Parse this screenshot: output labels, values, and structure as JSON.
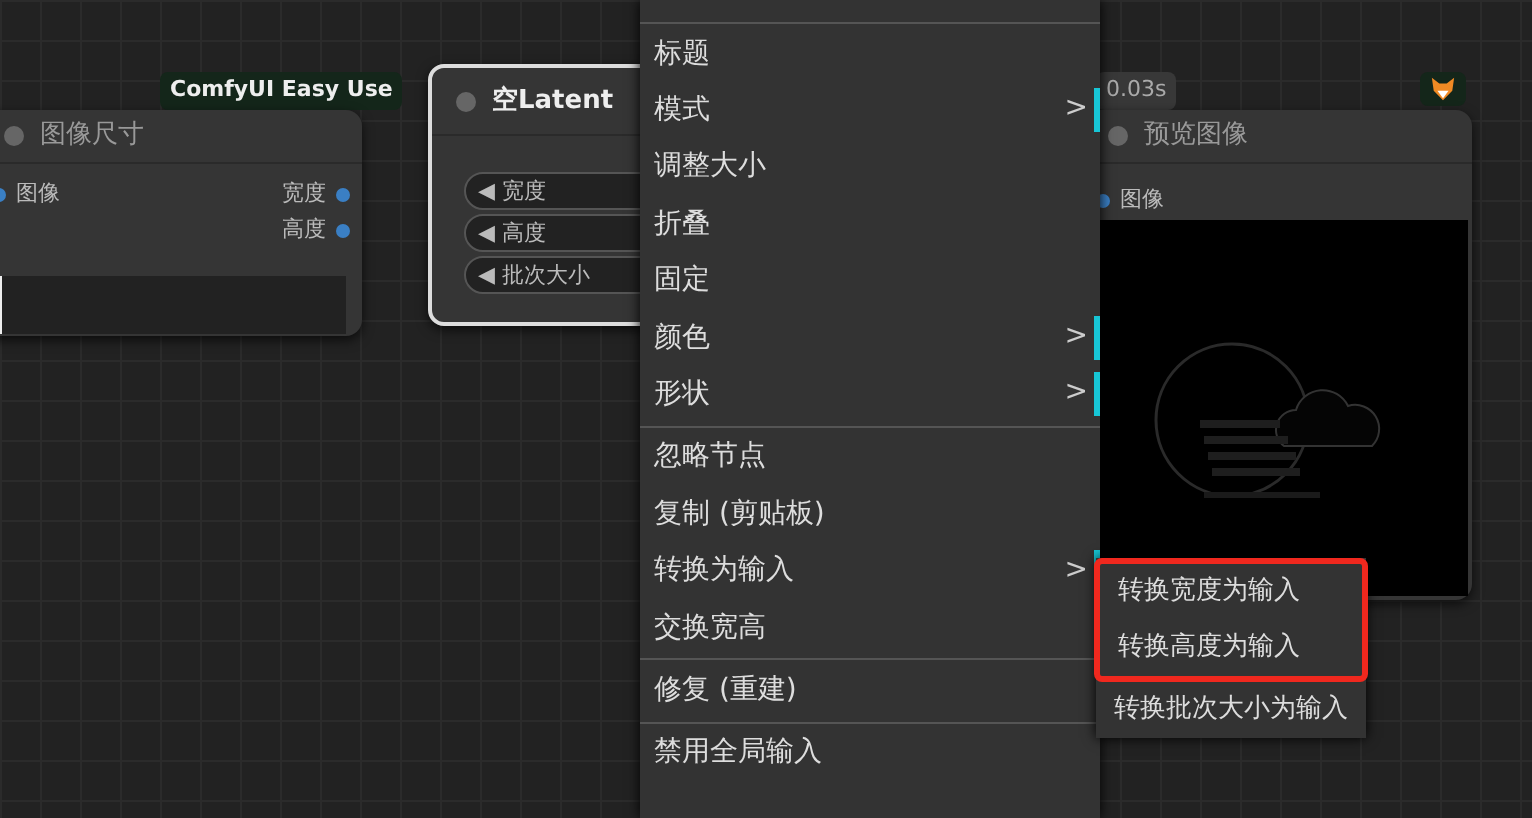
{
  "size_node": {
    "badge": "ComfyUI Easy Use",
    "title": "图像尺寸",
    "input": "图像",
    "outputs": [
      "宽度",
      "高度"
    ]
  },
  "latent_node": {
    "title": "空Latent",
    "selected": true,
    "widgets": [
      "◀ 宽度",
      "◀ 高度",
      "◀ 批次大小"
    ]
  },
  "preview_node": {
    "time": "0.03s",
    "title": "预览图像",
    "input": "图像"
  },
  "context_menu": {
    "items": [
      {
        "kind": "separator"
      },
      {
        "kind": "item",
        "label": "标题"
      },
      {
        "kind": "item",
        "label": "模式",
        "arrow": ">"
      },
      {
        "kind": "item",
        "label": "调整大小"
      },
      {
        "kind": "item",
        "label": "折叠"
      },
      {
        "kind": "item",
        "label": "固定"
      },
      {
        "kind": "item",
        "label": "颜色",
        "arrow": ">"
      },
      {
        "kind": "item",
        "label": "形状",
        "arrow": ">"
      },
      {
        "kind": "separator"
      },
      {
        "kind": "item",
        "label": "忽略节点"
      },
      {
        "kind": "item",
        "label": "复制 (剪贴板)"
      },
      {
        "kind": "item",
        "label": "转换为输入",
        "arrow": ">"
      },
      {
        "kind": "item",
        "label": "交换宽高"
      },
      {
        "kind": "separator"
      },
      {
        "kind": "item",
        "label": "修复 (重建)"
      },
      {
        "kind": "separator"
      },
      {
        "kind": "item",
        "label": "禁用全局输入"
      }
    ]
  },
  "submenu": {
    "items": [
      {
        "label": "转换宽度为输入",
        "highlighted": true
      },
      {
        "label": "转换高度为输入",
        "highlighted": true
      },
      {
        "label": "转换批次大小为输入",
        "highlighted": false
      }
    ]
  }
}
